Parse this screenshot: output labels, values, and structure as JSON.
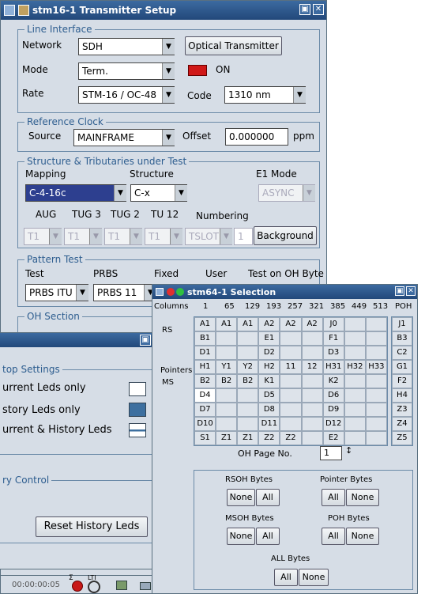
{
  "tx": {
    "title": "stm16-1 Transmitter Setup",
    "line_interface": {
      "legend": "Line Interface",
      "network_label": "Network",
      "network_value": "SDH",
      "optical_btn": "Optical Transmitter",
      "mode_label": "Mode",
      "mode_value": "Term.",
      "laser_state": "ON",
      "rate_label": "Rate",
      "rate_value": "STM-16 / OC-48",
      "code_label": "Code",
      "code_value": "1310 nm"
    },
    "ref_clock": {
      "legend": "Reference Clock",
      "source_label": "Source",
      "source_value": "MAINFRAME",
      "offset_label": "Offset",
      "offset_value": "0.000000",
      "unit": "ppm"
    },
    "structure": {
      "legend": "Structure & Tributaries under Test",
      "mapping_label": "Mapping",
      "structure_label": "Structure",
      "e1_label": "E1 Mode",
      "mapping_value": "C-4-16c",
      "structure_value": "C-x",
      "e1_value": "ASYNC",
      "aug": "AUG",
      "tug3": "TUG 3",
      "tug2": "TUG 2",
      "tu12": "TU 12",
      "numbering": "Numbering",
      "t1": "T1",
      "tslot": "TSLOT",
      "tslot_num": "1",
      "background_btn": "Background"
    },
    "pattern": {
      "legend": "Pattern Test",
      "test_label": "Test",
      "prbs_label": "PRBS",
      "fixed_label": "Fixed",
      "user_label": "User",
      "oh_label": "Test on OH Byte",
      "test_value": "PRBS ITU",
      "prbs_value": "PRBS 11"
    },
    "oh_section": {
      "legend": "OH Section"
    }
  },
  "leds": {
    "stop_legend": "top Settings",
    "current_only": "urrent Leds only",
    "history_only": "story Leds only",
    "current_history": "urrent & History Leds",
    "history_legend": "ry Control",
    "reset_btn": "Reset History Leds",
    "swatch_colors": [
      "#ffffff",
      "#3d6f9f",
      "#ffffff"
    ]
  },
  "taskbar": {
    "time": "00:00:00:05",
    "sigma": "Σ",
    "lti": "LTI"
  },
  "sel": {
    "title": "stm64-1 Selection",
    "columns_label": "Columns",
    "columns": [
      "1",
      "65",
      "129",
      "193",
      "257",
      "321",
      "385",
      "449",
      "513",
      "POH"
    ],
    "rs_label": "RS",
    "pointers_label": "Pointers",
    "ms_label": "MS",
    "rows": [
      [
        "A1",
        "A1",
        "A1",
        "A2",
        "A2",
        "A2",
        "J0",
        "",
        ""
      ],
      [
        "B1",
        "",
        "",
        "E1",
        "",
        "",
        "F1",
        "",
        ""
      ],
      [
        "D1",
        "",
        "",
        "D2",
        "",
        "",
        "D3",
        "",
        ""
      ],
      [
        "H1",
        "Y1",
        "Y2",
        "H2",
        "11",
        "12",
        "H31",
        "H32",
        "H33"
      ],
      [
        "B2",
        "B2",
        "B2",
        "K1",
        "",
        "",
        "K2",
        "",
        ""
      ],
      [
        "D4",
        "",
        "",
        "D5",
        "",
        "",
        "D6",
        "",
        ""
      ],
      [
        "D7",
        "",
        "",
        "D8",
        "",
        "",
        "D9",
        "",
        ""
      ],
      [
        "D10",
        "",
        "",
        "D11",
        "",
        "",
        "D12",
        "",
        ""
      ],
      [
        "S1",
        "Z1",
        "Z1",
        "Z2",
        "Z2",
        "",
        "E2",
        "",
        ""
      ]
    ],
    "poh": [
      "J1",
      "B3",
      "C2",
      "G1",
      "F2",
      "H4",
      "Z3",
      "Z4",
      "Z5"
    ],
    "page_label": "OH Page No.",
    "page_value": "1",
    "rsoh": "RSOH Bytes",
    "pointer": "Pointer Bytes",
    "msoh": "MSOH Bytes",
    "poh_bytes": "POH Bytes",
    "all_bytes": "ALL Bytes",
    "none": "None",
    "all": "All"
  }
}
